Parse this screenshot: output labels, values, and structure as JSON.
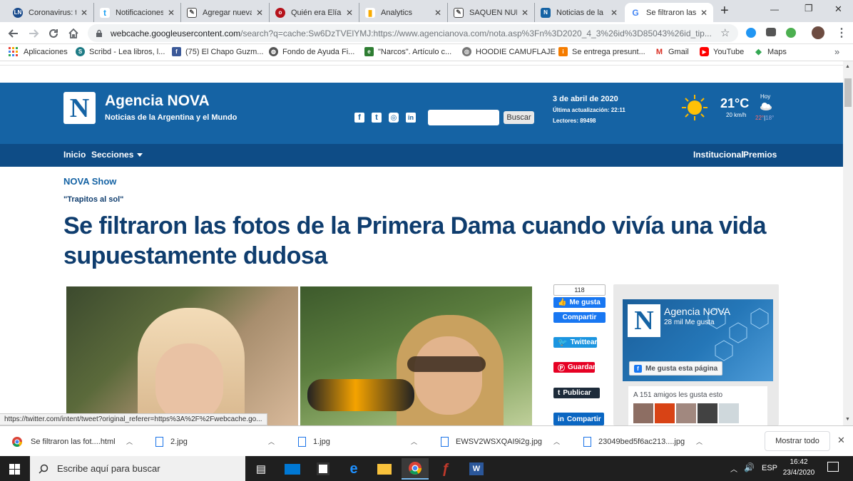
{
  "browser": {
    "tabs": [
      {
        "label": "Coronavirus: tr",
        "icon": "ln-icon",
        "color": "#1a4b8c",
        "glyph": "LN"
      },
      {
        "label": "Notificaciones",
        "icon": "twitter-icon",
        "color": "#1da1f2",
        "glyph": "t"
      },
      {
        "label": "Agregar nueva",
        "icon": "editor-icon",
        "color": "#444",
        "glyph": "✎"
      },
      {
        "label": "Quién era Elía",
        "icon": "news-icon",
        "color": "#b5121b",
        "glyph": "o"
      },
      {
        "label": "Analytics",
        "icon": "analytics-icon",
        "color": "#f9ab00",
        "glyph": "▮"
      },
      {
        "label": "SAQUEN NUM",
        "icon": "editor-icon",
        "color": "#444",
        "glyph": "✎"
      },
      {
        "label": "Noticias de la",
        "icon": "nova-icon",
        "color": "#1563a4",
        "glyph": "N"
      },
      {
        "label": "Se filtraron las",
        "icon": "google-icon",
        "color": "#4285f4",
        "glyph": "G"
      }
    ],
    "close_glyph": "✕",
    "new_tab_glyph": "+",
    "window_controls": [
      "—",
      "❐",
      "✕"
    ],
    "url": "webcache.googleusercontent.com",
    "url_rest": "/search?q=cache:Sw6DzTVElYMJ:https://www.agencianova.com/nota.asp%3Fn%3D2020_4_3%26id%3D85043%26id_tip...",
    "star_glyph": "☆",
    "bookmarks": [
      {
        "label": "Aplicaciones",
        "icon": "apps-icon",
        "color": "#e8453c",
        "glyph": "⋮"
      },
      {
        "label": "Scribd - Lea libros, l...",
        "icon": "scribd-icon",
        "color": "#1e7b85",
        "glyph": "S"
      },
      {
        "label": "(75) El Chapo Guzm...",
        "icon": "facebook-icon",
        "color": "#3b5998",
        "glyph": "f"
      },
      {
        "label": "Fondo de Ayuda Fi...",
        "icon": "globe-icon",
        "color": "#555",
        "glyph": "◍"
      },
      {
        "label": "\"Narcos\". Artículo c...",
        "icon": "narcos-icon",
        "color": "#2e7d32",
        "glyph": "e"
      },
      {
        "label": "HOODIE CAMUFLAJE",
        "icon": "shop-icon",
        "color": "#777",
        "glyph": "◎"
      },
      {
        "label": "Se entrega presunt...",
        "icon": "news-icon",
        "color": "#f57c00",
        "glyph": "i"
      },
      {
        "label": "Gmail",
        "icon": "gmail-icon",
        "color": "#d93025",
        "glyph": "M"
      },
      {
        "label": "YouTube",
        "icon": "youtube-icon",
        "color": "#ff0000",
        "glyph": "▶"
      },
      {
        "label": "Maps",
        "icon": "maps-icon",
        "color": "#34a853",
        "glyph": "◆"
      }
    ],
    "more_glyph": "»"
  },
  "site": {
    "logo_letter": "N",
    "name": "Agencia NOVA",
    "tagline": "Noticias de la Argentina y el Mundo",
    "social": [
      "f",
      "t",
      "◎",
      "in"
    ],
    "search_button": "Buscar",
    "date": "3 de abril de 2020",
    "updated": "Última actualización: 22:11",
    "readers": "Lectores: 89498",
    "temp": "21°C",
    "wind": "20 km/h",
    "today": "Hoy",
    "max": "22°",
    "min": "18°",
    "nav_left": [
      "Inicio",
      "Secciones"
    ],
    "nav_right": [
      "Institucional",
      "Premios"
    ]
  },
  "article": {
    "section": "NOVA Show",
    "kicker": "\"Trapitos al sol\"",
    "title": "Se filtraron las fotos de la Primera Dama cuando vivía una vida supuestamente dudosa"
  },
  "share": {
    "count": "118",
    "like": "Me gusta",
    "share": "Compartir",
    "tweet": "Twittear",
    "save": "Guardar",
    "tumblr": "Publicar",
    "linkedin": "Compartir"
  },
  "widget": {
    "name": "Agencia NOVA",
    "likes": "28 mil Me gusta",
    "like_page": "Me gusta esta página",
    "friends": "A 151 amigos les gusta esto"
  },
  "status_url": "https://twitter.com/intent/tweet?original_referer=https%3A%2F%2Fwebcache.go...",
  "downloads": [
    {
      "name": "Se filtraron las fot....html",
      "type": "chrome"
    },
    {
      "name": "2.jpg",
      "type": "file"
    },
    {
      "name": "1.jpg",
      "type": "file"
    },
    {
      "name": "EWSV2WSXQAI9i2g.jpg",
      "type": "file"
    },
    {
      "name": "23049bed5f6ac213....jpg",
      "type": "file"
    }
  ],
  "show_all": "Mostrar todo",
  "taskbar": {
    "search_placeholder": "Escribe aquí para buscar",
    "lang": "ESP",
    "time": "16:42",
    "date": "23/4/2020"
  },
  "colors": {
    "brand_blue": "#1563a4",
    "nav_dark": "#0e4c86",
    "title": "#0f3d6e"
  }
}
